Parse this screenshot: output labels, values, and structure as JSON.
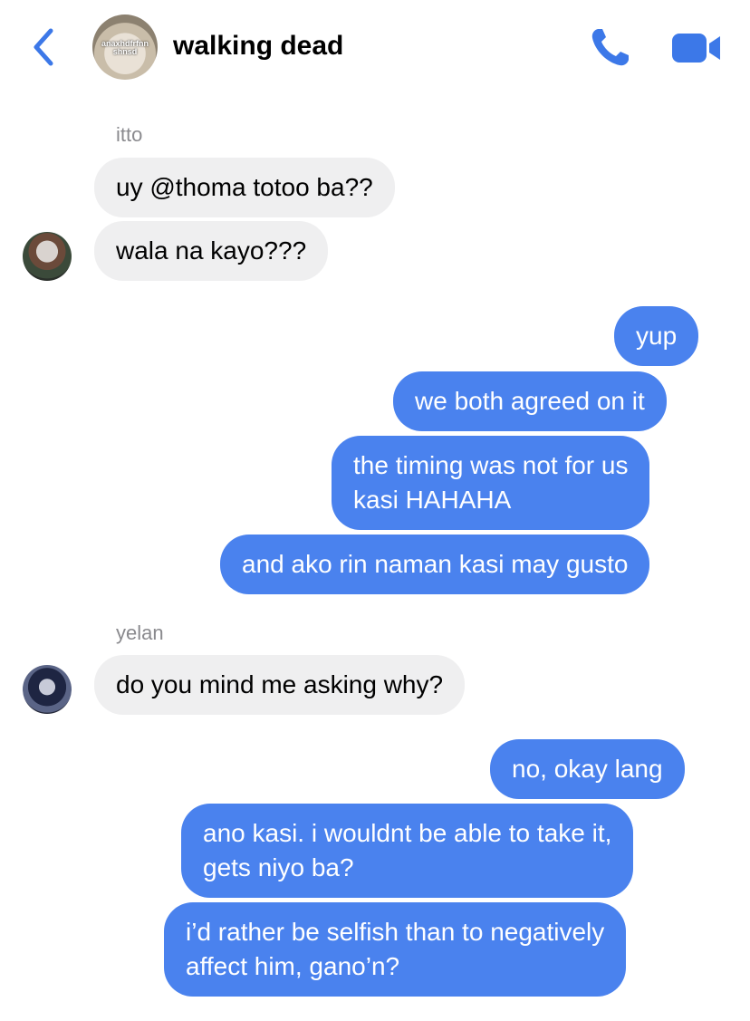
{
  "header": {
    "title": "walking dead",
    "group_avatar_caption": "anaxhdfrfnn shnsd",
    "accent_color": "#3c78e8"
  },
  "messages": [
    {
      "sender": "itto"
    },
    {
      "text": "uy @thoma totoo ba??"
    },
    {
      "text": "wala na kayo???"
    },
    {
      "text": "yup"
    },
    {
      "text": "we both agreed on it"
    },
    {
      "line1": "the timing was not for us",
      "line2": "kasi HAHAHA"
    },
    {
      "text": "and ako rin naman kasi may gusto"
    },
    {
      "sender": "yelan"
    },
    {
      "text": "do you mind me asking why?"
    },
    {
      "text": "no, okay lang"
    },
    {
      "line1": "ano kasi. i wouldnt be able to take it,",
      "line2": "gets niyo ba?"
    },
    {
      "line1": "i’d rather be selfish than to negatively",
      "line2": "affect him, gano’n?"
    }
  ],
  "colors": {
    "outgoing_bubble": "#4a82ee",
    "incoming_bubble": "#efeff0",
    "sender_label": "#8a8a8e"
  }
}
